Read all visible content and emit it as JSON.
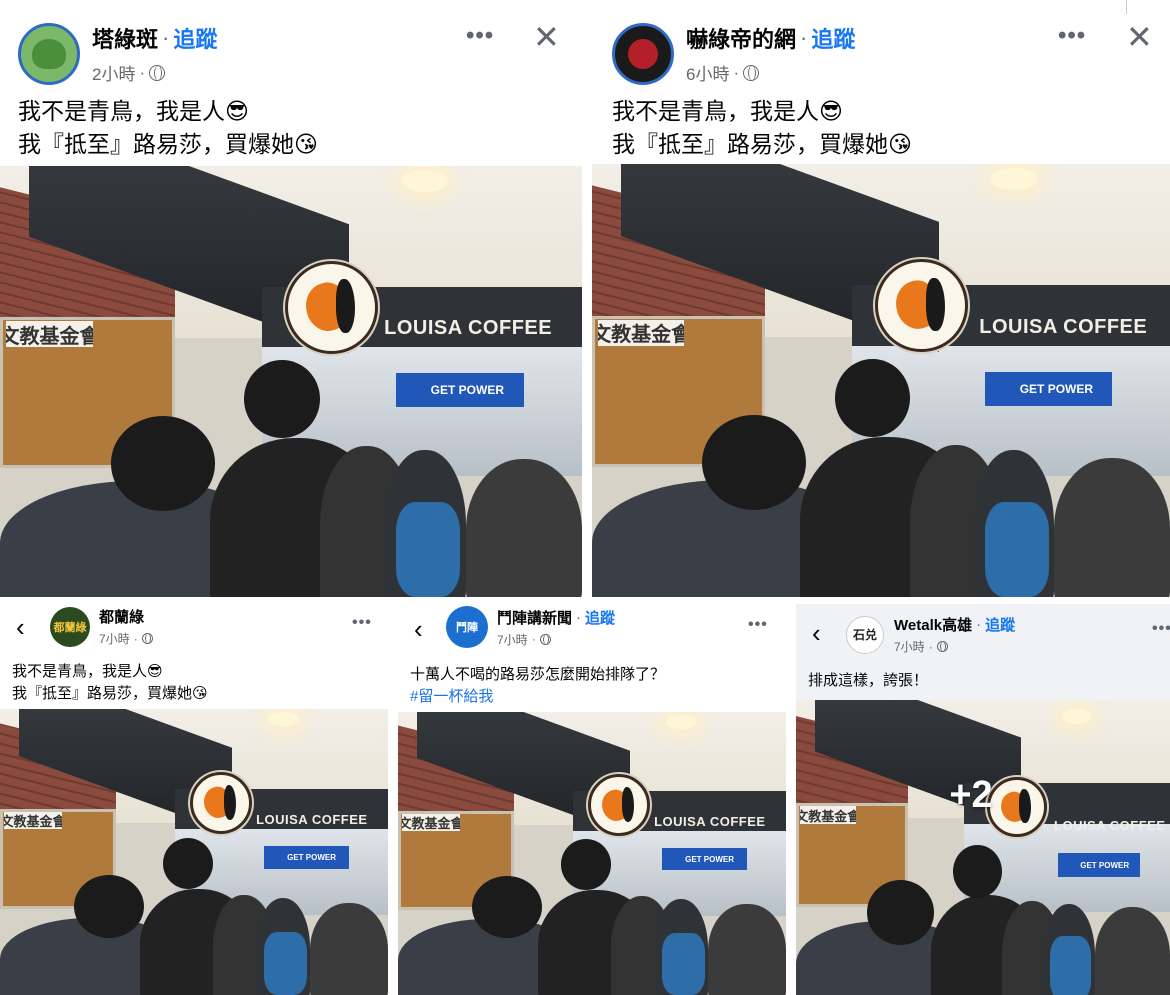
{
  "photo": {
    "store_name": "LOUISA COFFEE",
    "board_title": "文教基金會",
    "banner_text": "GET POWER"
  },
  "posts": [
    {
      "name": "塔綠斑",
      "follow": "追蹤",
      "time": "2小時",
      "lines": [
        "我不是青鳥，我是人😎",
        "我『抵至』路易莎，買爆她😘"
      ]
    },
    {
      "name": "嚇綠帝的網",
      "follow": "追蹤",
      "time": "6小時",
      "lines": [
        "我不是青鳥，我是人😎",
        "我『抵至』路易莎，買爆她😘"
      ]
    },
    {
      "name": "都蘭綠",
      "time": "7小時",
      "avatar_text": "都蘭綠",
      "lines": [
        "我不是青鳥，我是人😎",
        "我『抵至』路易莎，買爆她😘"
      ]
    },
    {
      "name": "鬥陣講新聞",
      "follow": "追蹤",
      "time": "7小時",
      "avatar_text": "鬥陣",
      "lines": [
        "十萬人不喝的路易莎怎麼開始排隊了？"
      ],
      "hashtag": "#留一杯給我"
    },
    {
      "name": "Wetalk高雄",
      "follow": "追蹤",
      "time": "7小時",
      "avatar_text": "石兑",
      "lines": [
        "排成這樣，誇張！"
      ],
      "more_photos": "+2"
    }
  ],
  "icons": {
    "more": "more-icon",
    "close": "close-icon",
    "back": "back-icon",
    "globe": "globe-icon"
  },
  "colors": {
    "follow": "#1877f2",
    "meta": "#65676b",
    "logo_orange": "#e9771c"
  }
}
